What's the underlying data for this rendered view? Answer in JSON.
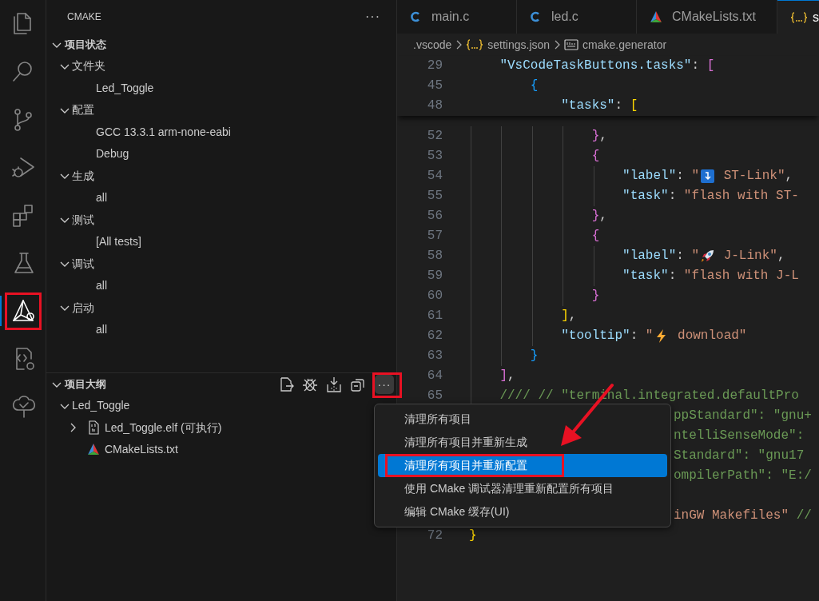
{
  "activity_bar": [
    {
      "kind": "files",
      "selected": false,
      "highlighted": false
    },
    {
      "kind": "search",
      "selected": false,
      "highlighted": false
    },
    {
      "kind": "git",
      "selected": false,
      "highlighted": false
    },
    {
      "kind": "debug",
      "selected": false,
      "highlighted": false
    },
    {
      "kind": "extensions",
      "selected": false,
      "highlighted": false
    },
    {
      "kind": "testing",
      "selected": false,
      "highlighted": false
    },
    {
      "kind": "cmake",
      "selected": true,
      "highlighted": true
    },
    {
      "kind": "remote",
      "selected": false,
      "highlighted": false
    },
    {
      "kind": "tree",
      "selected": false,
      "highlighted": false
    }
  ],
  "sidebar": {
    "title": "CMAKE",
    "more": "···",
    "status_section": {
      "title": "项目状态",
      "expanded": true,
      "items": [
        {
          "label": "文件夹",
          "expanded": true,
          "children": [
            {
              "label": "Led_Toggle"
            }
          ]
        },
        {
          "label": "配置",
          "expanded": true,
          "children": [
            {
              "label": "GCC 13.3.1 arm-none-eabi"
            },
            {
              "label": "Debug"
            }
          ]
        },
        {
          "label": "生成",
          "expanded": true,
          "children": [
            {
              "label": "all"
            }
          ]
        },
        {
          "label": "测试",
          "expanded": true,
          "children": [
            {
              "label": "[All tests]"
            }
          ]
        },
        {
          "label": "调试",
          "expanded": true,
          "children": [
            {
              "label": "all"
            }
          ]
        },
        {
          "label": "启动",
          "expanded": true,
          "children": [
            {
              "label": "all"
            }
          ]
        }
      ]
    },
    "outline_section": {
      "title": "项目大纲",
      "expanded": true,
      "toolbar": [
        {
          "kind": "file",
          "highlighted": false
        },
        {
          "kind": "bug",
          "highlighted": false
        },
        {
          "kind": "install",
          "highlighted": false
        },
        {
          "kind": "collapse",
          "highlighted": false
        },
        {
          "kind": "more",
          "label": "···",
          "highlighted": true
        }
      ],
      "items": [
        {
          "label": "Led_Toggle",
          "expanded": true,
          "children": [
            {
              "label": "Led_Toggle.elf (可执行)",
              "kind": "binary",
              "expanded": false
            },
            {
              "label": "CMakeLists.txt",
              "kind": "cmake"
            }
          ]
        }
      ]
    }
  },
  "tabs": [
    {
      "label": "main.c",
      "kind": "c",
      "selected": false
    },
    {
      "label": "led.c",
      "kind": "c",
      "selected": false
    },
    {
      "label": "CMakeLists.txt",
      "kind": "cmake",
      "selected": false
    },
    {
      "label": "s",
      "kind": "json",
      "selected": true
    }
  ],
  "breadcrumb": [
    {
      "label": ".vscode",
      "kind": "folder"
    },
    {
      "label": "settings.json",
      "kind": "json"
    },
    {
      "label": "cmake.generator",
      "kind": "text"
    }
  ],
  "sticky_lines": [
    {
      "num": "29",
      "tokens": [
        {
          "kind": "key",
          "text": "    \"VsCodeTaskButtons.tasks\""
        },
        {
          "kind": "punct",
          "text": ": "
        },
        {
          "kind": "brace2",
          "text": "["
        }
      ]
    },
    {
      "num": "45",
      "tokens": [
        {
          "kind": "brace3",
          "text": "        {"
        }
      ]
    },
    {
      "num": "48",
      "tokens": [
        {
          "kind": "key",
          "text": "            \"tasks\""
        },
        {
          "kind": "punct",
          "text": ": "
        },
        {
          "kind": "brace1",
          "text": "["
        }
      ]
    }
  ],
  "lines": [
    {
      "num": "52",
      "tokens": [
        {
          "kind": "brace2",
          "text": "                }"
        },
        {
          "kind": "punct",
          "text": ","
        }
      ]
    },
    {
      "num": "53",
      "tokens": [
        {
          "kind": "brace2",
          "text": "                {"
        }
      ]
    },
    {
      "num": "54",
      "tokens": [
        {
          "kind": "key",
          "text": "                    \"label\""
        },
        {
          "kind": "punct",
          "text": ": "
        },
        {
          "kind": "string",
          "text": "\""
        },
        {
          "kind": "emoji"
        },
        {
          "kind": "string",
          "text": " ST-Link\""
        },
        {
          "kind": "punct",
          "text": ","
        }
      ]
    },
    {
      "num": "55",
      "tokens": [
        {
          "kind": "key",
          "text": "                    \"task\""
        },
        {
          "kind": "punct",
          "text": ": "
        },
        {
          "kind": "string",
          "text": "\"flash with ST-"
        }
      ]
    },
    {
      "num": "56",
      "tokens": [
        {
          "kind": "brace2",
          "text": "                }"
        },
        {
          "kind": "punct",
          "text": ","
        }
      ]
    },
    {
      "num": "57",
      "tokens": [
        {
          "kind": "brace2",
          "text": "                {"
        }
      ]
    },
    {
      "num": "58",
      "tokens": [
        {
          "kind": "key",
          "text": "                    \"label\""
        },
        {
          "kind": "punct",
          "text": ": "
        },
        {
          "kind": "string",
          "text": "\""
        },
        {
          "kind": "emoji"
        },
        {
          "kind": "string",
          "text": " J-Link\""
        },
        {
          "kind": "punct",
          "text": ","
        }
      ]
    },
    {
      "num": "59",
      "tokens": [
        {
          "kind": "key",
          "text": "                    \"task\""
        },
        {
          "kind": "punct",
          "text": ": "
        },
        {
          "kind": "string",
          "text": "\"flash with J-L"
        }
      ]
    },
    {
      "num": "60",
      "tokens": [
        {
          "kind": "brace2",
          "text": "                }"
        }
      ]
    },
    {
      "num": "61",
      "tokens": [
        {
          "kind": "brace1",
          "text": "            ]"
        },
        {
          "kind": "punct",
          "text": ","
        }
      ]
    },
    {
      "num": "62",
      "tokens": [
        {
          "kind": "key",
          "text": "            \"tooltip\""
        },
        {
          "kind": "punct",
          "text": ": "
        },
        {
          "kind": "string",
          "text": "\""
        },
        {
          "kind": "emoji"
        },
        {
          "kind": "string",
          "text": " download\""
        }
      ]
    },
    {
      "num": "63",
      "tokens": [
        {
          "kind": "brace3",
          "text": "        }"
        }
      ]
    },
    {
      "num": "64",
      "tokens": [
        {
          "kind": "brace2",
          "text": "    ]"
        },
        {
          "kind": "punct",
          "text": ","
        }
      ]
    },
    {
      "num": "65",
      "tokens": [
        {
          "kind": "comment",
          "text": "    //// // \"terminal.integrated.defaultPro"
        }
      ]
    },
    {
      "covered": true,
      "tokens": [
        {
          "kind": "comment",
          "text": "ppStandard\": \"gnu+"
        }
      ]
    },
    {
      "covered": true,
      "tokens": [
        {
          "kind": "comment",
          "text": "ntelliSenseMode\":"
        }
      ]
    },
    {
      "covered": true,
      "tokens": [
        {
          "kind": "comment",
          "text": "Standard\": \"gnu17"
        }
      ]
    },
    {
      "covered": true,
      "tokens": [
        {
          "kind": "comment",
          "text": "ompilerPath\": \"E:/"
        }
      ]
    },
    {
      "covered": true
    },
    {
      "covered": true,
      "tokens": [
        {
          "kind": "string",
          "text": "inGW Makefiles\""
        },
        {
          "kind": "comment",
          "text": " //"
        }
      ]
    },
    {
      "num": "72",
      "tokens": [
        {
          "kind": "brace1",
          "text": "}"
        }
      ]
    }
  ],
  "context_menu": [
    {
      "label": "清理所有项目",
      "selected": false,
      "highlighted": false
    },
    {
      "label": "清理所有项目并重新生成",
      "selected": false,
      "highlighted": false
    },
    {
      "label": "清理所有项目并重新配置",
      "selected": true,
      "highlighted": true
    },
    {
      "label": "使用 CMake 调试器清理重新配置所有项目",
      "selected": false,
      "highlighted": false
    },
    {
      "label": "编辑 CMake 缓存(UI)",
      "selected": false,
      "highlighted": false
    }
  ]
}
